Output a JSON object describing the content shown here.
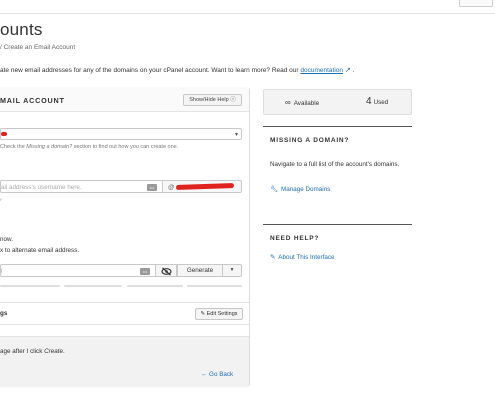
{
  "page": {
    "title": "ounts",
    "breadcrumb": "/  Create an Email Account",
    "intro_text": "ate new email addresses for any of the domains on your cPanel account. Want to learn more? Read our",
    "intro_link": "documentation",
    "intro_end": "."
  },
  "form": {
    "section_title": "MAIL ACCOUNT",
    "help_button": "Show/Hide Help ⓘ",
    "domain_hint_prefix": "Check the",
    "domain_hint_em": "Missing a domain?",
    "domain_hint_suffix": "section to find out how you can create one.",
    "username_placeholder": "ail address's username here.",
    "domain_prefix": "@",
    "username_tick": "›",
    "now_text": "now.",
    "alt_text": "x to alternate email address.",
    "password_value": "l",
    "generate_label": "Generate",
    "settings_label": "gs",
    "edit_settings_label": "Edit Settings",
    "stay_text_prefix": "age after I click",
    "stay_text_em": "Create",
    "stay_text_end": ".",
    "go_back_label": "← Go Back"
  },
  "sidebar": {
    "available_symbol": "∞",
    "available_label": "Available",
    "used_count": "4",
    "used_label": "Used",
    "missing_title": "MISSING A DOMAIN?",
    "missing_text": "Navigate to a full list of the account's domains.",
    "manage_link": "Manage Domains",
    "help_title": "NEED HELP?",
    "about_link": "About This Interface"
  },
  "colors": {
    "link": "#1f6fb5",
    "redaction": "#e0221f"
  },
  "icons": [
    "external-link-icon",
    "dropdown-caret-icon",
    "key-icon",
    "eye-slash-icon",
    "pencil-icon",
    "wrench-icon",
    "edit-box-icon",
    "infinity-icon"
  ]
}
